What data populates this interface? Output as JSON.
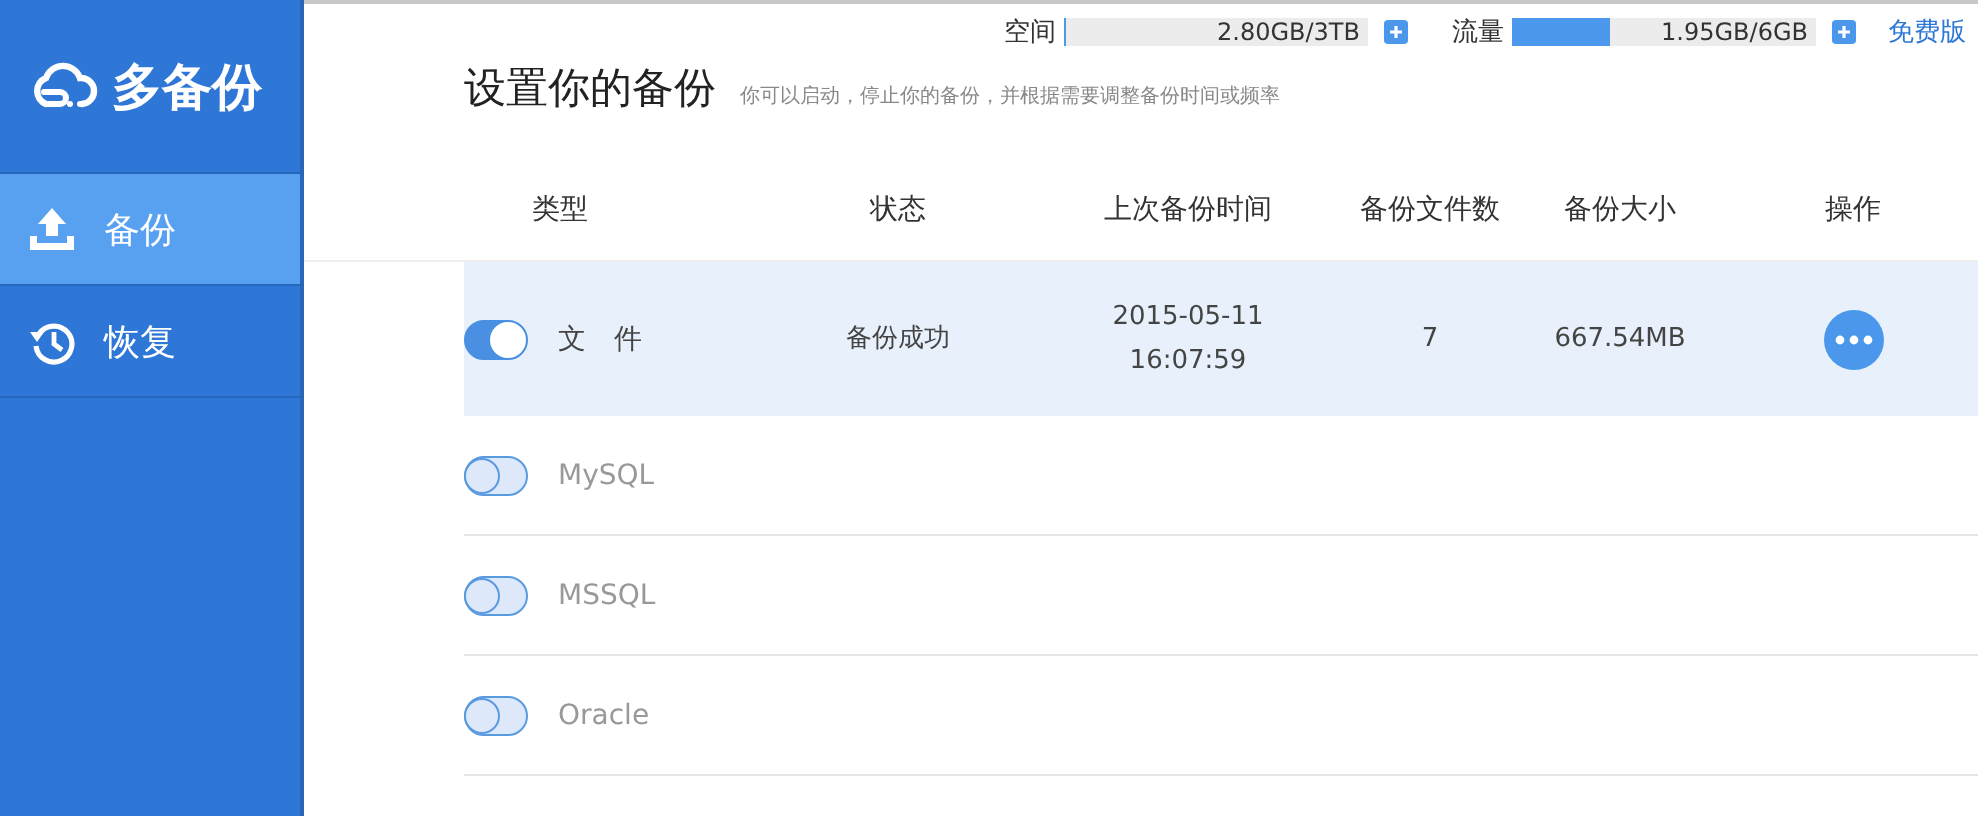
{
  "sidebar": {
    "logo_text": "多备份",
    "items": [
      {
        "label": "备份",
        "kind": "backup",
        "selected": true
      },
      {
        "label": "恢复",
        "kind": "restore",
        "selected": false
      }
    ]
  },
  "quota": [
    {
      "label": "空间",
      "level": 0.001,
      "reading": "2.80GB/3TB"
    },
    {
      "label": "流量",
      "level": 0.32,
      "reading": "1.95GB/6GB"
    }
  ],
  "plan_link": "免费版",
  "heading": {
    "title": "设置你的备份",
    "subtitle": "你可以启动，停止你的备份，并根据需要调整备份时间或频率"
  },
  "table": {
    "columns": [
      "类型",
      "状态",
      "上次备份时间",
      "备份文件数",
      "备份大小",
      "操作"
    ],
    "rows": [
      {
        "type": "文　件",
        "enabled": true,
        "selected": true,
        "status": "备份成功",
        "last_backup": "2015-05-11\n16:07:59",
        "files": "7",
        "size": "667.54MB"
      },
      {
        "type": "MySQL",
        "enabled": false,
        "selected": false
      },
      {
        "type": "MSSQL",
        "enabled": false,
        "selected": false
      },
      {
        "type": "Oracle",
        "enabled": false,
        "selected": false
      }
    ]
  }
}
